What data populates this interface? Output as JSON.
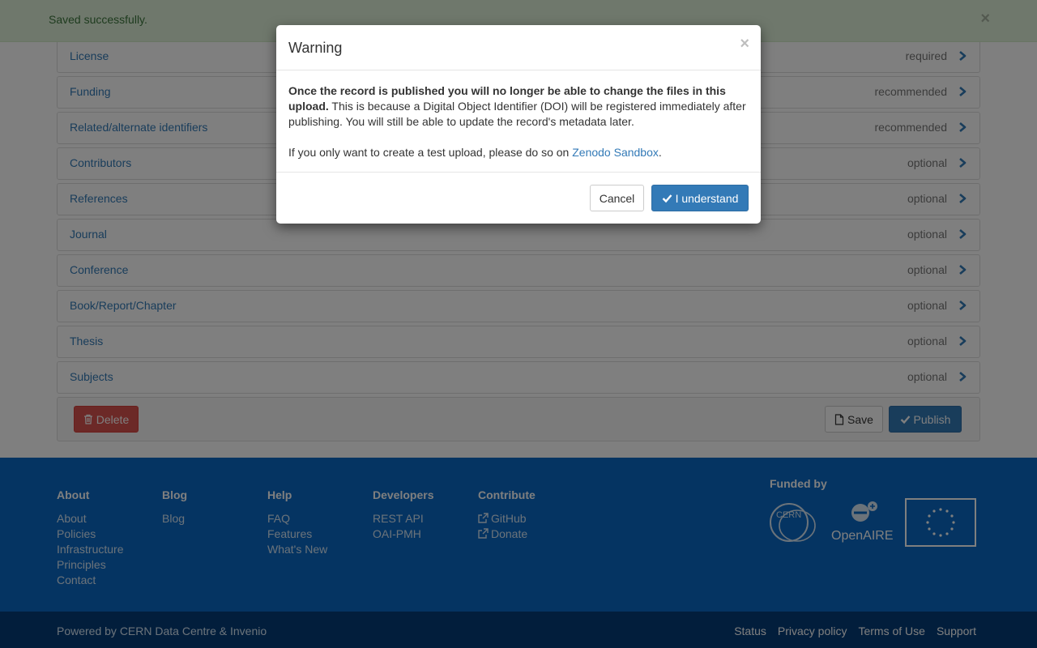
{
  "alert": {
    "text": "Saved successfully.",
    "close": "×"
  },
  "panels": [
    {
      "title": "License",
      "status": "required"
    },
    {
      "title": "Funding",
      "status": "recommended"
    },
    {
      "title": "Related/alternate identifiers",
      "status": "recommended"
    },
    {
      "title": "Contributors",
      "status": "optional"
    },
    {
      "title": "References",
      "status": "optional"
    },
    {
      "title": "Journal",
      "status": "optional"
    },
    {
      "title": "Conference",
      "status": "optional"
    },
    {
      "title": "Book/Report/Chapter",
      "status": "optional"
    },
    {
      "title": "Thesis",
      "status": "optional"
    },
    {
      "title": "Subjects",
      "status": "optional"
    }
  ],
  "actions": {
    "delete": "Delete",
    "save": "Save",
    "publish": "Publish"
  },
  "footer": {
    "columns": [
      {
        "heading": "About",
        "links": [
          "About",
          "Policies",
          "Infrastructure",
          "Principles",
          "Contact"
        ]
      },
      {
        "heading": "Blog",
        "links": [
          "Blog"
        ]
      },
      {
        "heading": "Help",
        "links": [
          "FAQ",
          "Features",
          "What's New"
        ]
      },
      {
        "heading": "Developers",
        "links": [
          "REST API",
          "OAI-PMH"
        ]
      },
      {
        "heading": "Contribute",
        "links": [
          "GitHub",
          "Donate"
        ]
      }
    ],
    "funded_by": "Funded by",
    "logos": {
      "cern": "CERN",
      "openaire": "OpenAIRE"
    }
  },
  "subfooter": {
    "powered": "Powered by CERN Data Centre & Invenio",
    "links": [
      "Status",
      "Privacy policy",
      "Terms of Use",
      "Support"
    ]
  },
  "modal": {
    "title": "Warning",
    "close": "×",
    "bold_text": "Once the record is published you will no longer be able to change the files in this upload.",
    "body_text": "This is because a Digital Object Identifier (DOI) will be registered immediately after publishing. You will still be able to update the record's metadata later.",
    "second_prefix": "If you only want to create a test upload, please do so on ",
    "sandbox_link": "Zenodo Sandbox",
    "second_suffix": ".",
    "cancel": "Cancel",
    "confirm": "I understand"
  },
  "colors": {
    "primary": "#337ab7",
    "danger": "#d9534f",
    "success_bg": "#dff0d8",
    "footer_bg": "#0b69c4",
    "subfooter_bg": "#053d78"
  },
  "icons": {
    "panel_chevron": "chevron-right-icon",
    "delete": "trash-icon",
    "save": "file-icon",
    "publish": "check-icon",
    "external": "external-link-icon"
  }
}
